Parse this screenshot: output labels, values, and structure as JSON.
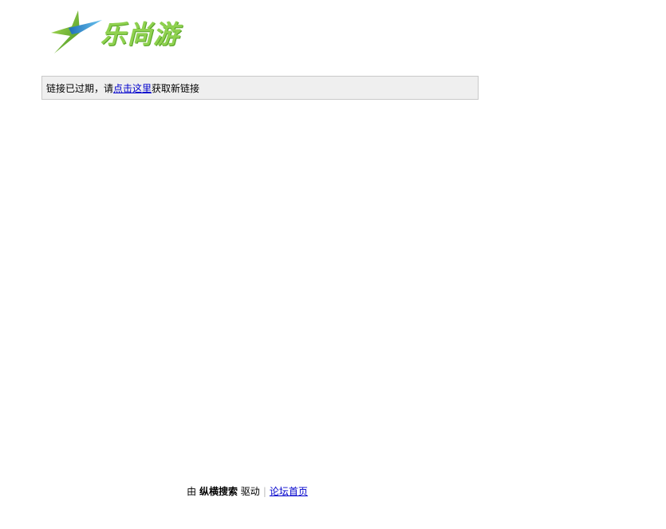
{
  "logo": {
    "text": "乐尚游",
    "colors": {
      "green": "#8fd14f",
      "blue": "#2b9bd8",
      "dark_green": "#3f8f1e"
    },
    "icon": "star-swoosh-icon"
  },
  "notice": {
    "prefix": "链接已过期，请",
    "link_label": "点击这里",
    "suffix": "获取新链接"
  },
  "footer": {
    "by": "由",
    "brand": "纵横搜索",
    "powered": "驱动",
    "separator": "|",
    "home_link": "论坛首页"
  }
}
